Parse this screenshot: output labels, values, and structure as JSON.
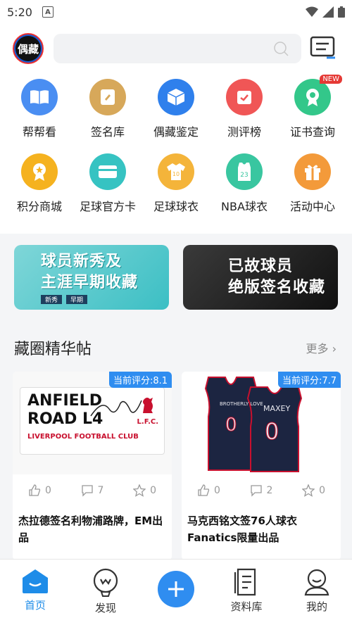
{
  "status": {
    "time": "5:20"
  },
  "header": {
    "logo_text": "偶藏"
  },
  "grid": [
    {
      "label": "帮帮看",
      "icon": "book-icon",
      "color": "#4a8ef2"
    },
    {
      "label": "签名库",
      "icon": "signature-icon",
      "color": "#d7a85a"
    },
    {
      "label": "偶藏鉴定",
      "icon": "cube-icon",
      "color": "#2f80ec"
    },
    {
      "label": "测评榜",
      "icon": "check-calendar-icon",
      "color": "#f05656"
    },
    {
      "label": "证书查询",
      "icon": "certificate-icon",
      "color": "#33c78a",
      "badge": "NEW"
    },
    {
      "label": "积分商城",
      "icon": "medal-icon",
      "color": "#f5b21f"
    },
    {
      "label": "足球官方卡",
      "icon": "card-icon",
      "color": "#36c3c2"
    },
    {
      "label": "足球球衣",
      "icon": "jersey-icon",
      "color": "#f4b43a"
    },
    {
      "label": "NBA球衣",
      "icon": "nba-jersey-icon",
      "color": "#39c6a0"
    },
    {
      "label": "活动中心",
      "icon": "gift-icon",
      "color": "#f39a3a"
    }
  ],
  "banners": [
    {
      "line1": "球员新秀及",
      "line2": "主涯早期收藏",
      "tag1": "新秀",
      "tag2": "早期"
    },
    {
      "line1": "已故球员",
      "line2": "绝版签名收藏"
    }
  ],
  "section": {
    "title": "藏圈精华帖",
    "more": "更多"
  },
  "cards": [
    {
      "score": "当前评分:8.1",
      "img_line1": "ANFIELD",
      "img_line2": "ROAD L4",
      "img_line3": "LIVERPOOL FOOTBALL CLUB",
      "img_logo": "L.F.C.",
      "likes": "0",
      "comments": "7",
      "favs": "0",
      "title": "杰拉德签名利物浦路牌，EM出品"
    },
    {
      "score": "当前评分:7.7",
      "img_name": "MAXEY",
      "img_number": "0",
      "img_team": "BROTHERLY LOVE",
      "likes": "0",
      "comments": "2",
      "favs": "0",
      "title": "马克西铭文签76人球衣Fanatics限量出品"
    }
  ],
  "tabs": [
    {
      "label": "首页",
      "icon": "home-icon",
      "active": true
    },
    {
      "label": "发现",
      "icon": "discover-icon"
    },
    {
      "label": "",
      "icon": "plus-icon"
    },
    {
      "label": "资料库",
      "icon": "library-icon"
    },
    {
      "label": "我的",
      "icon": "profile-icon"
    }
  ]
}
